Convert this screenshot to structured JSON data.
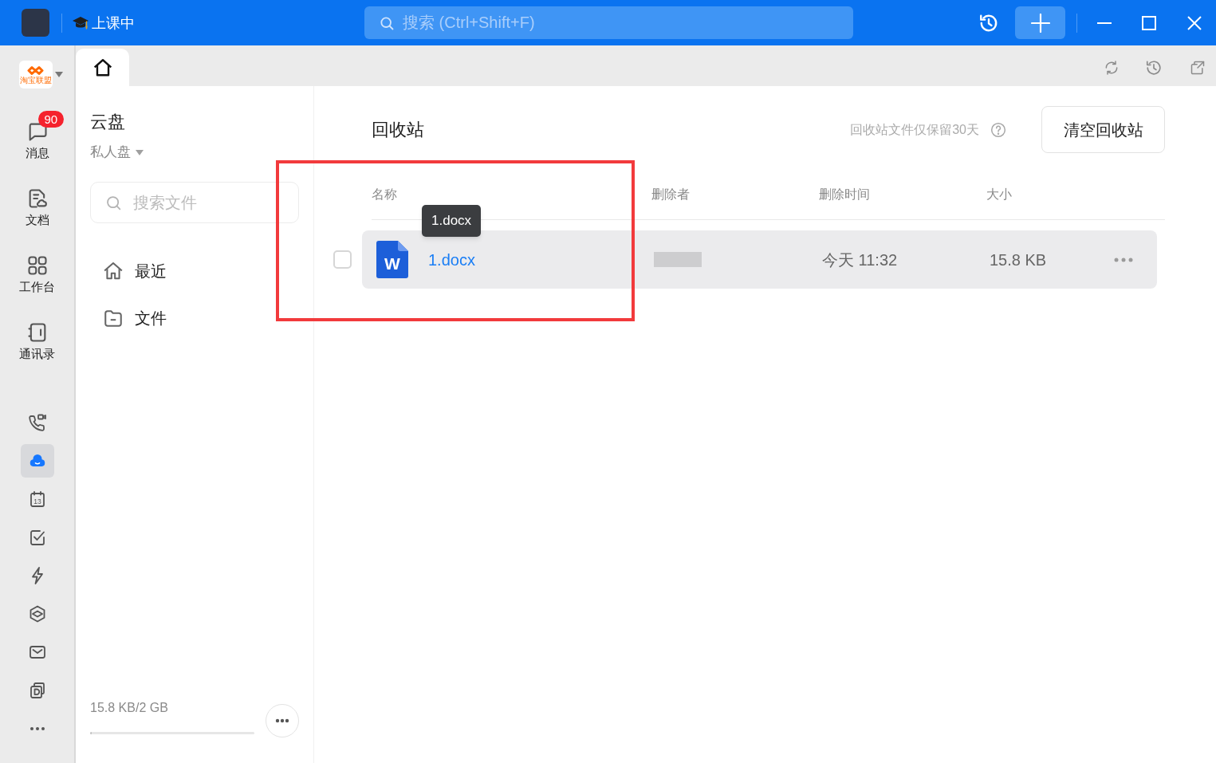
{
  "title_bar": {
    "status": "上课中",
    "search": {
      "placeholder": "搜索 (Ctrl+Shift+F)"
    }
  },
  "sidebar": {
    "logo_text": "淘宝联盟",
    "apps": [
      {
        "label": "消息",
        "selected": false,
        "badge": "90"
      },
      {
        "label": "文档",
        "selected": false
      },
      {
        "label": "工作台",
        "selected": false
      },
      {
        "label": "通讯录",
        "selected": false
      }
    ],
    "tools": [
      {
        "selected": false
      },
      {
        "selected": true
      },
      {
        "selected": false,
        "day": "13"
      },
      {
        "selected": false
      },
      {
        "selected": false
      },
      {
        "selected": false
      },
      {
        "selected": false
      },
      {
        "selected": false
      },
      {
        "selected": false
      }
    ]
  },
  "tabs": [
    {
      "selected": true
    }
  ],
  "drive_panel": {
    "title": "云盘",
    "space": "私人盘",
    "search": {
      "placeholder": "搜索文件"
    },
    "nav": [
      {
        "label": "最近",
        "selected": false
      },
      {
        "label": "文件",
        "selected": false
      }
    ],
    "storage": {
      "usage": "15.8 KB/2 GB",
      "level": 0
    }
  },
  "recycle_bin": {
    "title": "回收站",
    "note": "回收站文件仅保留30天",
    "empty_button": "清空回收站",
    "columns": [
      "名称",
      "删除者",
      "删除时间",
      "大小"
    ],
    "rows": [
      {
        "name": "1.docx",
        "icon_letter": "W",
        "deleter_redacted": true,
        "deleted_at": "今天 11:32",
        "size": "15.8 KB",
        "checked": false,
        "highlighted": true
      }
    ],
    "tooltip": {
      "text": "1.docx"
    }
  },
  "highlight_frame": true
}
